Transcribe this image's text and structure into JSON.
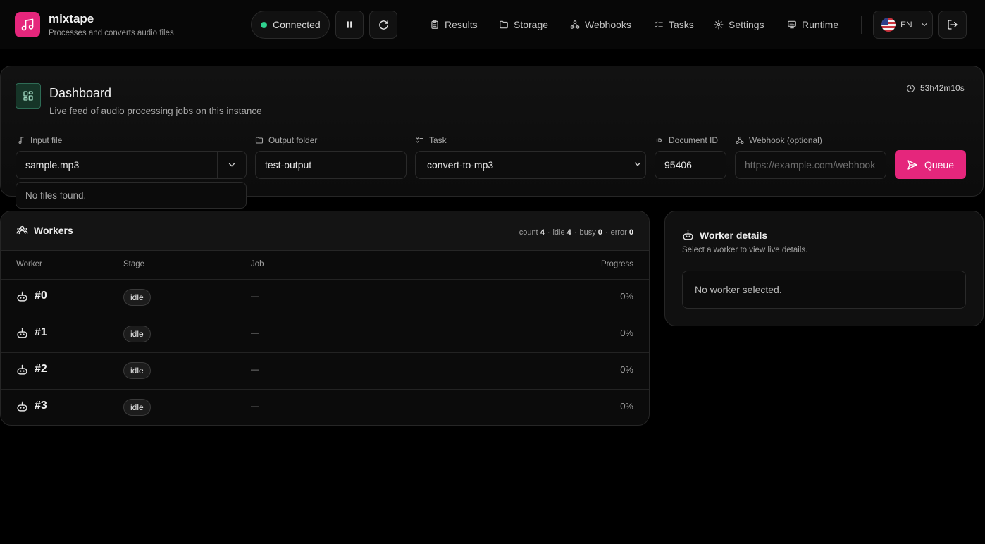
{
  "app": {
    "name": "mixtape",
    "tagline": "Processes and converts audio files"
  },
  "header": {
    "connection_status": "Connected",
    "status_color": "#2fd38f",
    "accent_color": "#e5267c",
    "nav": [
      {
        "label": "Results",
        "icon": "clipboard-icon"
      },
      {
        "label": "Storage",
        "icon": "folder-icon"
      },
      {
        "label": "Webhooks",
        "icon": "webhook-icon"
      },
      {
        "label": "Tasks",
        "icon": "list-checks-icon"
      },
      {
        "label": "Settings",
        "icon": "gear-icon"
      },
      {
        "label": "Runtime",
        "icon": "monitor-icon"
      }
    ],
    "language": "EN"
  },
  "dashboard": {
    "title": "Dashboard",
    "subtitle": "Live feed of audio processing jobs on this instance",
    "uptime": "53h42m10s",
    "form": {
      "input_file": {
        "label": "Input file",
        "value": "sample.mp3"
      },
      "output_folder": {
        "label": "Output folder",
        "value": "test-output"
      },
      "task": {
        "label": "Task",
        "value": "convert-to-mp3"
      },
      "document_id": {
        "label": "Document ID",
        "value": "95406"
      },
      "webhook": {
        "label": "Webhook (optional)",
        "placeholder": "https://example.com/webhook"
      },
      "queue_label": "Queue"
    },
    "file_dropdown_message": "No files found."
  },
  "workers": {
    "title": "Workers",
    "stats": [
      {
        "label": "count",
        "value": "4"
      },
      {
        "label": "idle",
        "value": "4"
      },
      {
        "label": "busy",
        "value": "0"
      },
      {
        "label": "error",
        "value": "0"
      }
    ],
    "columns": [
      "Worker",
      "Stage",
      "Job",
      "Progress"
    ],
    "rows": [
      {
        "name": "#0",
        "stage": "idle",
        "job": "—",
        "progress": "0%"
      },
      {
        "name": "#1",
        "stage": "idle",
        "job": "—",
        "progress": "0%"
      },
      {
        "name": "#2",
        "stage": "idle",
        "job": "—",
        "progress": "0%"
      },
      {
        "name": "#3",
        "stage": "idle",
        "job": "—",
        "progress": "0%"
      }
    ]
  },
  "worker_details": {
    "title": "Worker details",
    "subtitle": "Select a worker to view live details.",
    "empty_message": "No worker selected."
  }
}
